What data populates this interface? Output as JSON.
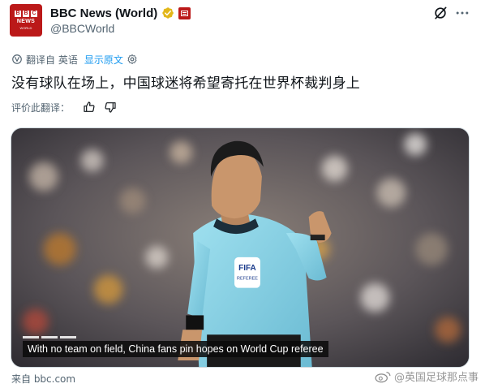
{
  "author": {
    "display_name": "BBC News (World)",
    "handle": "@BBCWorld",
    "avatar": {
      "letters": [
        "B",
        "B",
        "C"
      ],
      "line1": "NEWS",
      "line2": "WORLD"
    }
  },
  "icons": {
    "verified": "verified-badge-icon",
    "affiliate": "bbc-affiliate-icon",
    "grok": "grok-icon",
    "more": "more-options-icon",
    "translate": "translate-icon",
    "settings": "settings-gear-icon",
    "thumbs_up": "thumbs-up-icon",
    "thumbs_down": "thumbs-down-icon"
  },
  "colors": {
    "brand_red": "#bb1919",
    "link_blue": "#1d9bf0",
    "verified_gold": "#e2b719",
    "referee_shirt": "#8ad3e6"
  },
  "translation": {
    "label": "翻译自 英语",
    "show_original": "显示原文"
  },
  "post": {
    "text": "没有球队在场上，中国球迷将希望寄托在世界杯裁判身上"
  },
  "rating": {
    "label": "评价此翻译："
  },
  "media": {
    "caption": "With no team on field, China fans pin hopes on World Cup referee",
    "badge_top": "FIFA",
    "badge_bottom": "REFEREE"
  },
  "source": "来自 bbc.com",
  "watermark": "@英国足球那点事"
}
